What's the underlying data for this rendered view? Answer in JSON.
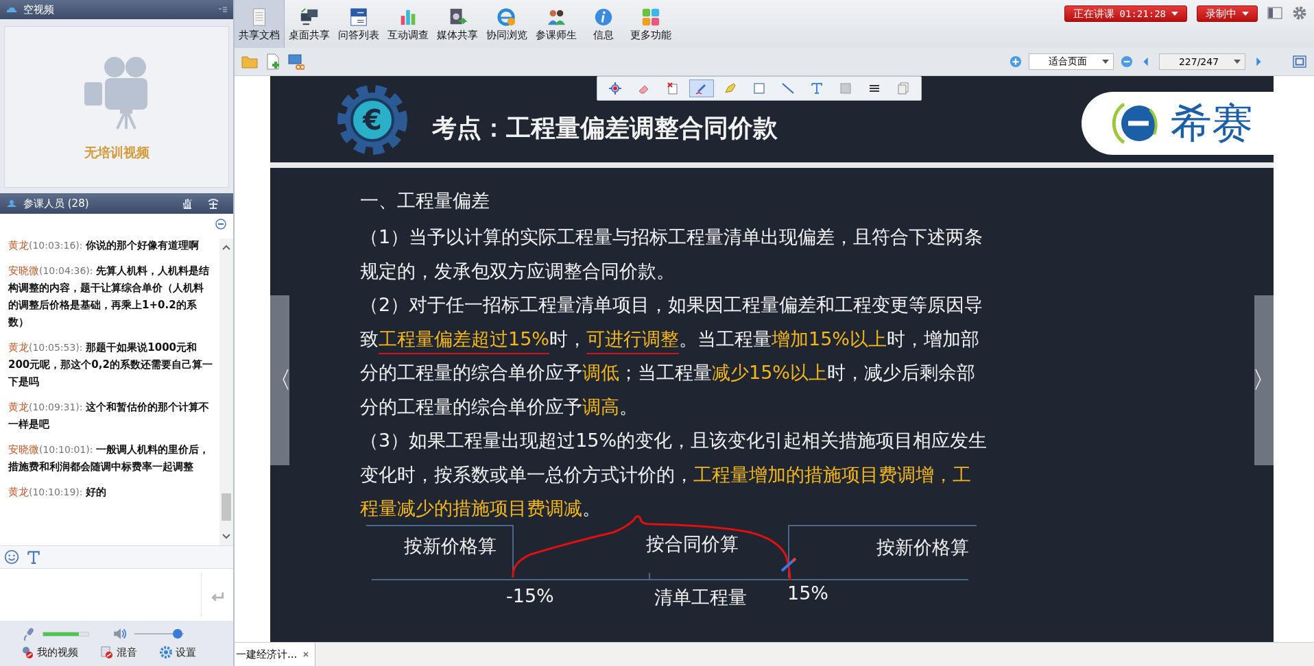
{
  "video_panel": {
    "title": "空视频",
    "message": "无培训视频"
  },
  "participants_panel": {
    "title": "参课人员 (28)"
  },
  "chat": {
    "messages": [
      {
        "name": "黄龙",
        "time": "(10:03:16):",
        "text": "你说的那个好像有道理啊"
      },
      {
        "name": "安晓微",
        "time": "(10:04:36):",
        "text": "先算人机料，人机料是结构调整的内容，题干让算综合单价（人机料的调整后价格是基础，再乘上1+0.2的系数）"
      },
      {
        "name": "黄龙",
        "time": "(10:05:53):",
        "text": "那题干如果说1000元和200元呢，那这个0,2的系数还需要自己算一下是吗"
      },
      {
        "name": "黄龙",
        "time": "(10:09:31):",
        "text": "这个和暂估价的那个计算不一样是吧"
      },
      {
        "name": "安晓微",
        "time": "(10:10:01):",
        "text": "一般调人机料的里价后，措施费和利润都会随调中标费率一起调整"
      },
      {
        "name": "黄龙",
        "time": "(10:10:19):",
        "text": "好的"
      }
    ]
  },
  "microphone": {
    "level": 0.79
  },
  "speaker": {
    "level": 0.87
  },
  "bottom_buttons": [
    {
      "label": "我的视频",
      "kind": "video"
    },
    {
      "label": "混音",
      "kind": "mix"
    },
    {
      "label": "设置",
      "kind": "settings"
    }
  ],
  "toolbar": [
    {
      "label": "共享文档",
      "kind": "doc",
      "selected": true
    },
    {
      "label": "桌面共享",
      "kind": "desktop",
      "selected": false
    },
    {
      "label": "问答列表",
      "kind": "qa",
      "selected": false
    },
    {
      "label": "互动调查",
      "kind": "chart",
      "selected": false
    },
    {
      "label": "媒体共享",
      "kind": "media",
      "selected": false
    },
    {
      "label": "协同浏览",
      "kind": "browser",
      "selected": false
    },
    {
      "label": "参课师生",
      "kind": "people",
      "selected": false
    },
    {
      "label": "信息",
      "kind": "info",
      "selected": false
    },
    {
      "label": "更多功能",
      "kind": "more",
      "selected": false
    }
  ],
  "status": {
    "live": "正在讲课",
    "timer": "01:21:28",
    "recording": "录制中"
  },
  "doc_toolbar": {
    "zoom": "适合页面",
    "page": "227/247"
  },
  "annotation_tools": [
    {
      "kind": "pointer",
      "selected": false
    },
    {
      "kind": "eraser",
      "selected": false
    },
    {
      "kind": "clear",
      "selected": false
    },
    {
      "kind": "pen",
      "selected": true
    },
    {
      "kind": "highlighter",
      "selected": false
    },
    {
      "kind": "rect",
      "selected": false
    },
    {
      "kind": "line",
      "selected": false
    },
    {
      "kind": "text",
      "selected": false
    },
    {
      "kind": "fill",
      "selected": false
    },
    {
      "kind": "width",
      "selected": false
    },
    {
      "kind": "copy",
      "selected": false
    }
  ],
  "slide": {
    "symbol": "€",
    "title": "考点：工程量偏差调整合同价款",
    "logo": "希赛",
    "heading": "一、工程量偏差",
    "paragraphs": [
      [
        {
          "text": "（1）当予以计算的实际工程量与招标工程量清单出现偏差，且符合下述两条规定的，发承包双方应调整合同价款。",
          "highlight": false,
          "underlined": false
        }
      ],
      [
        {
          "text": "（2）对于任一招标工程量清单项目，如果因工程量偏差和工程变更等原因导致",
          "highlight": false,
          "underlined": false
        },
        {
          "text": "工程量偏差超过15%",
          "highlight": true,
          "underlined": true
        },
        {
          "text": "时，",
          "highlight": false,
          "underlined": false
        },
        {
          "text": "可进行调整",
          "highlight": true,
          "underlined": true
        },
        {
          "text": "。当工程量",
          "highlight": false,
          "underlined": false
        },
        {
          "text": "增加15%以上",
          "highlight": true,
          "underlined": false
        },
        {
          "text": "时，增加部分的工程量的综合单价应予",
          "highlight": false,
          "underlined": false
        },
        {
          "text": "调低",
          "highlight": true,
          "underlined": false
        },
        {
          "text": "；当工程量",
          "highlight": false,
          "underlined": false
        },
        {
          "text": "减少15%以上",
          "highlight": true,
          "underlined": false
        },
        {
          "text": "时，减少后剩余部分的工程量的综合单价应予",
          "highlight": false,
          "underlined": false
        },
        {
          "text": "调高",
          "highlight": true,
          "underlined": false
        },
        {
          "text": "。",
          "highlight": false,
          "underlined": false
        }
      ],
      [
        {
          "text": "（3）如果工程量出现超过15%的变化，且该变化引起相关措施项目相应发生变化时，按系数或单一总价方式计价的，",
          "highlight": false,
          "underlined": false
        },
        {
          "text": "工程量增加的措施项目费调增，工程量减少的措施项目费调减",
          "highlight": true,
          "underlined": false
        },
        {
          "text": "。",
          "highlight": false,
          "underlined": false
        }
      ]
    ],
    "diagram": {
      "left": "按新价格算",
      "middle": "按合同价算",
      "right": "按新价格算",
      "low": "-15%",
      "axis": "清单工程量",
      "high": "15%"
    }
  },
  "nav": {
    "prev": "〈",
    "next": "〉"
  },
  "tabs": [
    {
      "label": "一建经济计...",
      "selected": true
    }
  ]
}
